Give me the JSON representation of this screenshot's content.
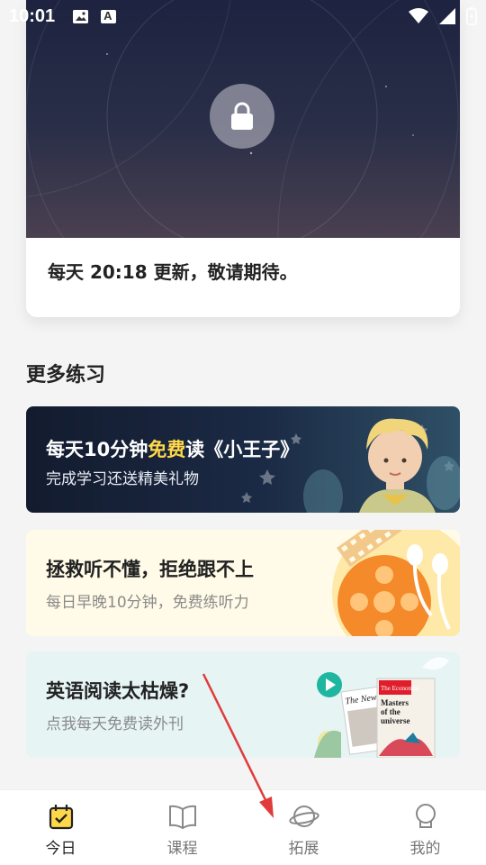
{
  "status_bar": {
    "time": "10:01"
  },
  "lesson": {
    "update_text": "每天 20:18 更新，敬请期待。"
  },
  "more_practice": {
    "section_title": "更多练习",
    "promos": [
      {
        "title_pre": "每天10分钟",
        "title_em": "免费",
        "title_post": "读《小王子》",
        "subtitle": "完成学习还送精美礼物"
      },
      {
        "title": "拯救听不懂，拒绝跟不上",
        "subtitle": "每日早晚10分钟，免费练听力"
      },
      {
        "title": "英语阅读太枯燥?",
        "subtitle": "点我每天免费读外刊",
        "magazine": {
          "brand": "The Economist",
          "headline_1": "Masters",
          "headline_2": "of the",
          "headline_3": "universe",
          "secondary": "The New Y"
        }
      }
    ]
  },
  "bottom_nav": {
    "items": [
      {
        "label": "今日",
        "icon": "calendar-check-icon",
        "active": true
      },
      {
        "label": "课程",
        "icon": "book-icon",
        "active": false
      },
      {
        "label": "拓展",
        "icon": "planet-icon",
        "active": false
      },
      {
        "label": "我的",
        "icon": "profile-icon",
        "active": false
      }
    ]
  },
  "colors": {
    "accent": "#ffd84a",
    "highlight": "#ffe87a",
    "annotation_arrow": "#e23b3b"
  }
}
